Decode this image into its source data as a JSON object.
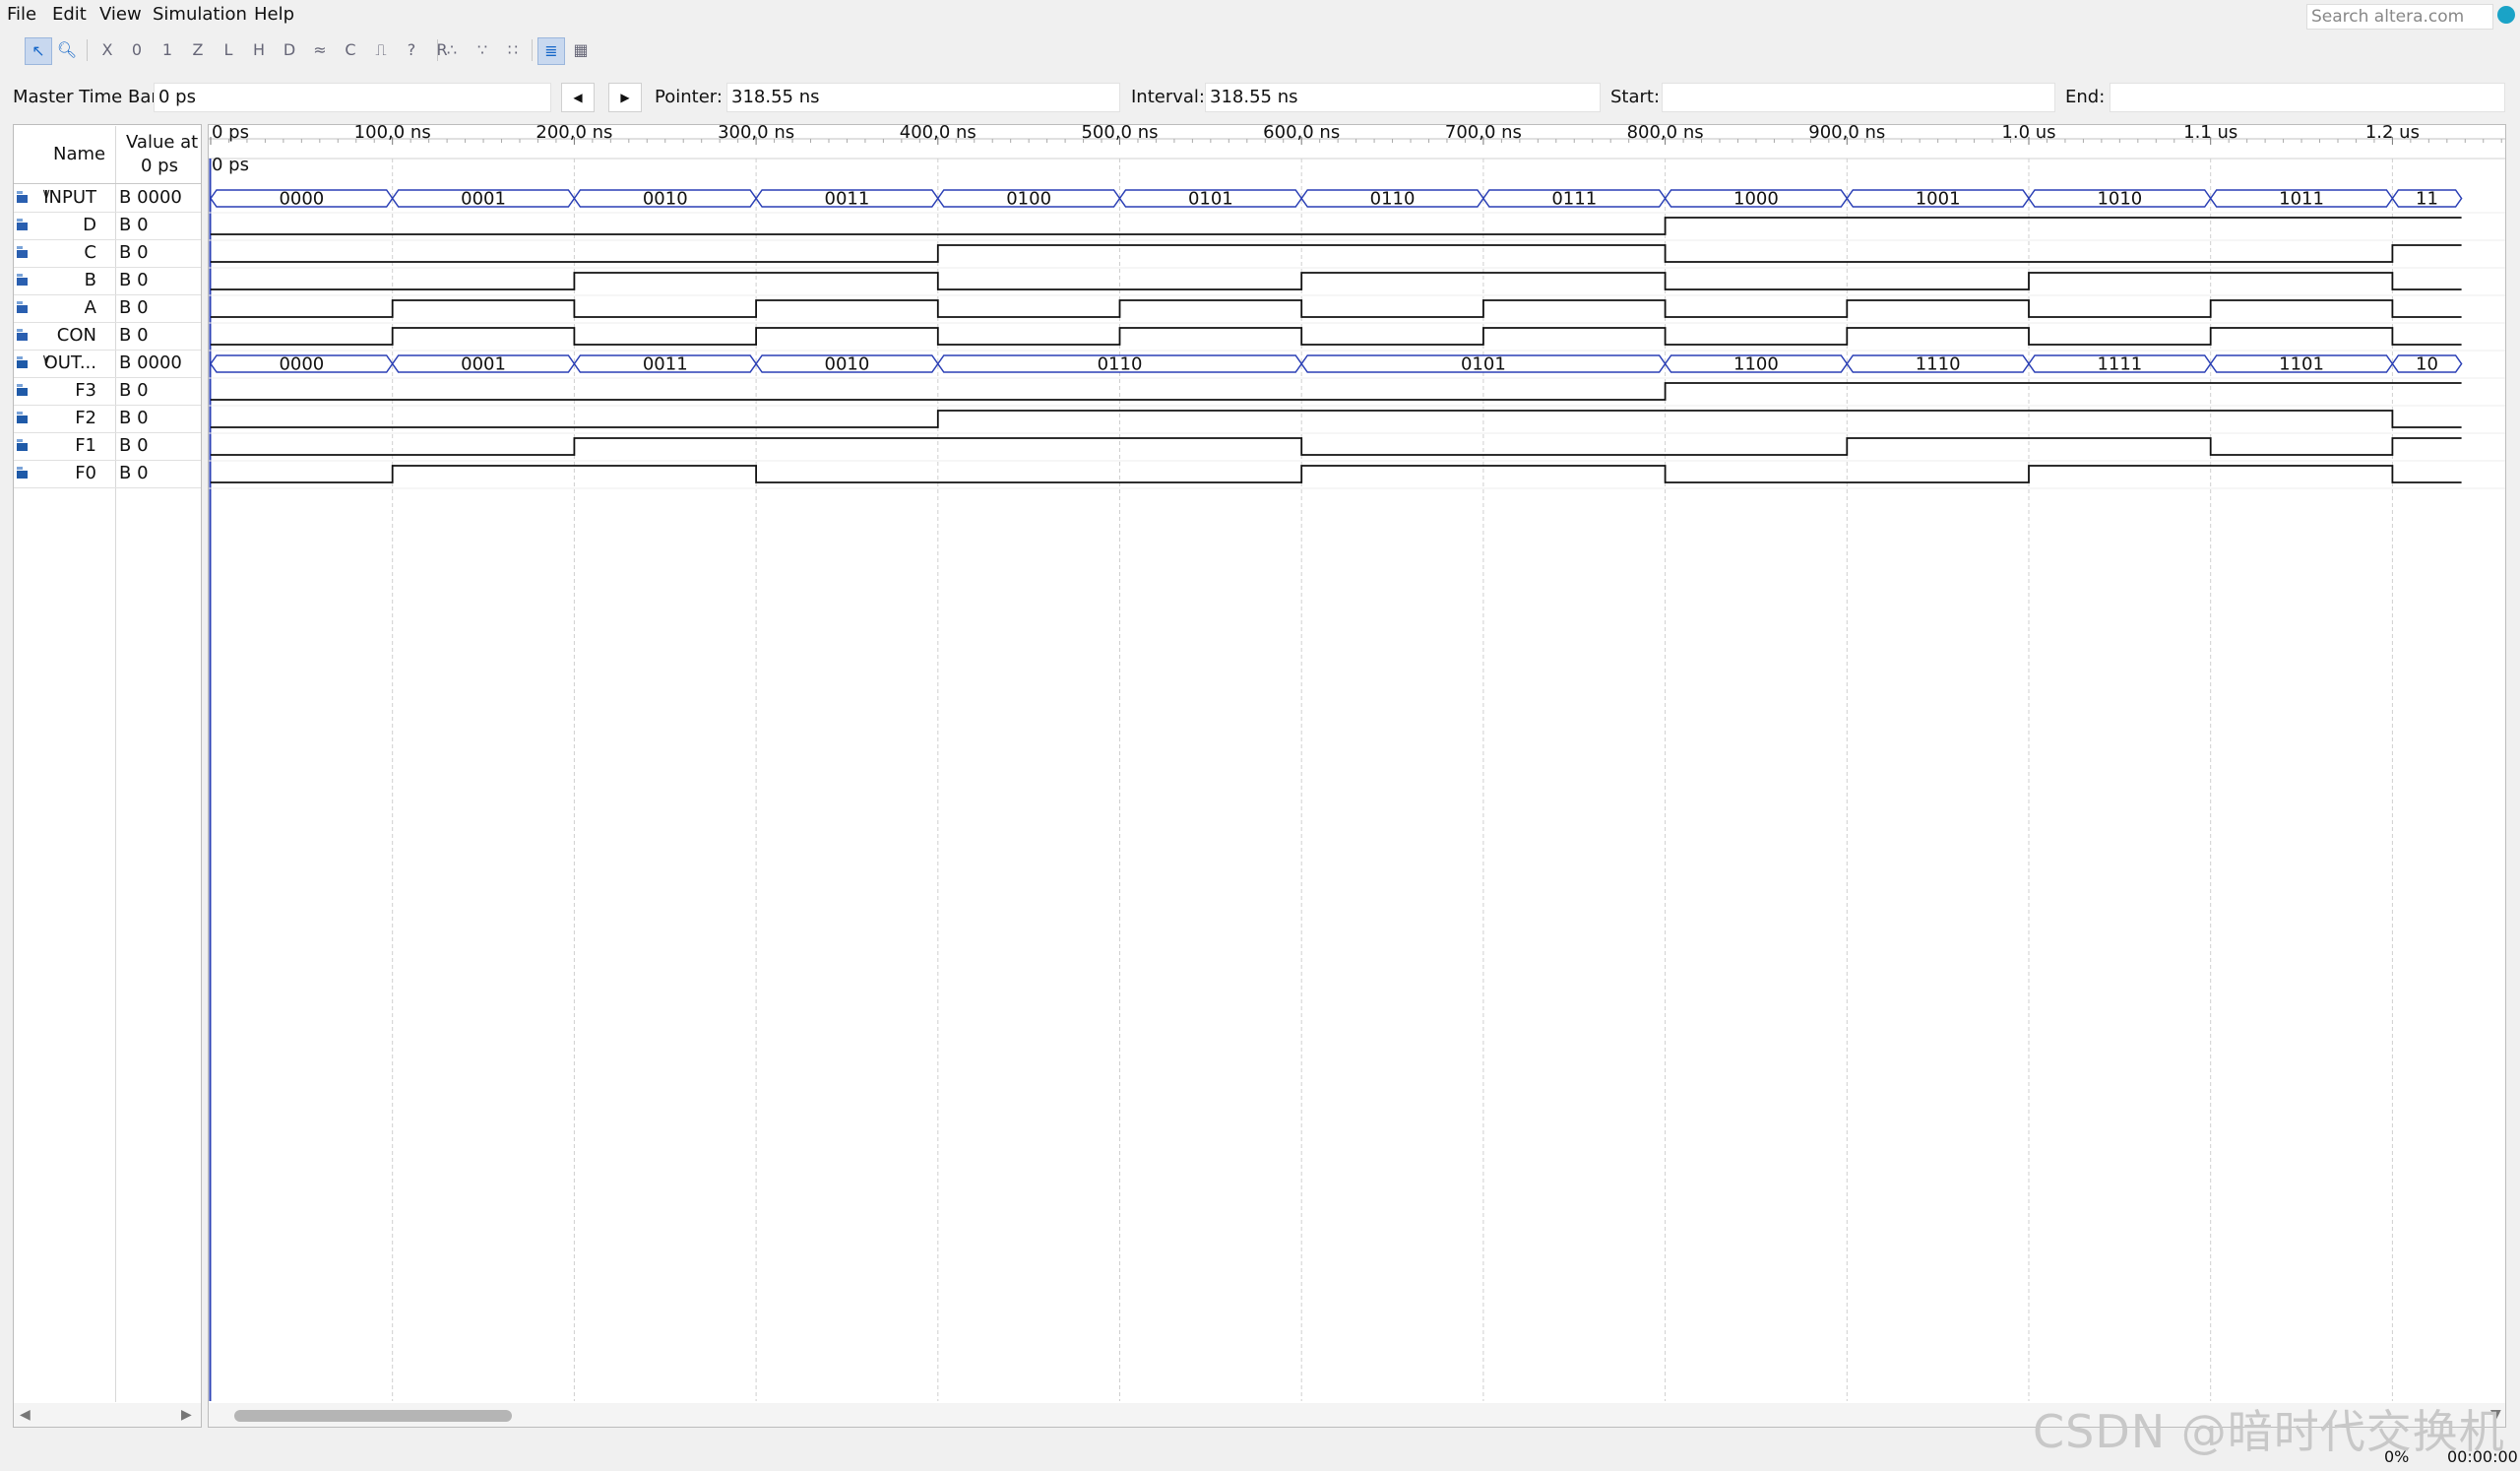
{
  "menu": [
    "File",
    "Edit",
    "View",
    "Simulation",
    "Help"
  ],
  "search": {
    "placeholder": "Search altera.com"
  },
  "toolbar": {
    "icons": [
      "pointer-icon",
      "zoom-icon",
      "force-unknown-icon",
      "force-low-icon",
      "force-high-icon",
      "force-hiz-icon",
      "force-weak-low-icon",
      "force-weak-high-icon",
      "force-dont-care-icon",
      "invert-icon",
      "count-value-icon",
      "clock-icon",
      "arbitrary-value-icon",
      "random-value-icon",
      "snap-to-grid-icon",
      "group-icon",
      "ungroup-icon",
      "waveform-compare-icon",
      "grid-icon"
    ]
  },
  "timebar": {
    "master_label": "Master Time Bar:",
    "master_value": "0 ps",
    "pointer_label": "Pointer:",
    "pointer_value": "318.55 ns",
    "interval_label": "Interval:",
    "interval_value": "318.55 ns",
    "start_label": "Start:",
    "start_value": "",
    "end_label": "End:",
    "end_value": ""
  },
  "header": {
    "name": "Name",
    "value_at": "Value at",
    "value_time": "0 ps",
    "cursor_label": "0 ps"
  },
  "ruler": [
    "0 ps",
    "100,0 ns",
    "200,0 ns",
    "300,0 ns",
    "400,0 ns",
    "500,0 ns",
    "600,0 ns",
    "700,0 ns",
    "800,0 ns",
    "900,0 ns",
    "1.0 us",
    "1.1 us",
    "1.2 us"
  ],
  "signals": [
    {
      "name": "INPUT",
      "value": "B 0000",
      "type": "in-bus",
      "expanded": true,
      "segments": [
        {
          "t": 0,
          "v": "0000"
        },
        {
          "t": 100,
          "v": "0001"
        },
        {
          "t": 200,
          "v": "0010"
        },
        {
          "t": 300,
          "v": "0011"
        },
        {
          "t": 400,
          "v": "0100"
        },
        {
          "t": 500,
          "v": "0101"
        },
        {
          "t": 600,
          "v": "0110"
        },
        {
          "t": 700,
          "v": "0111"
        },
        {
          "t": 800,
          "v": "1000"
        },
        {
          "t": 900,
          "v": "1001"
        },
        {
          "t": 1000,
          "v": "1010"
        },
        {
          "t": 1100,
          "v": "1011"
        },
        {
          "t": 1200,
          "v": "11"
        }
      ]
    },
    {
      "name": "D",
      "value": "B 0",
      "type": "in",
      "levels": [
        0,
        0,
        0,
        0,
        0,
        0,
        0,
        0,
        1,
        1,
        1,
        1,
        1
      ]
    },
    {
      "name": "C",
      "value": "B 0",
      "type": "in",
      "levels": [
        0,
        0,
        0,
        0,
        1,
        1,
        1,
        1,
        0,
        0,
        0,
        0,
        1
      ]
    },
    {
      "name": "B",
      "value": "B 0",
      "type": "in",
      "levels": [
        0,
        0,
        1,
        1,
        0,
        0,
        1,
        1,
        0,
        0,
        1,
        1,
        0
      ]
    },
    {
      "name": "A",
      "value": "B 0",
      "type": "in",
      "levels": [
        0,
        1,
        0,
        1,
        0,
        1,
        0,
        1,
        0,
        1,
        0,
        1,
        0
      ]
    },
    {
      "name": "CON",
      "value": "B 0",
      "type": "in",
      "levels": [
        0,
        1,
        0,
        1,
        0,
        1,
        0,
        1,
        0,
        1,
        0,
        1,
        0
      ]
    },
    {
      "name": "OUT...",
      "value": "B 0000",
      "type": "out-bus",
      "expanded": true,
      "segments": [
        {
          "t": 0,
          "v": "0000"
        },
        {
          "t": 100,
          "v": "0001"
        },
        {
          "t": 200,
          "v": "0011"
        },
        {
          "t": 300,
          "v": "0010"
        },
        {
          "t": 400,
          "v": "0110"
        },
        {
          "t": 600,
          "v": "0101"
        },
        {
          "t": 800,
          "v": "1100"
        },
        {
          "t": 900,
          "v": "1110"
        },
        {
          "t": 1000,
          "v": "1111"
        },
        {
          "t": 1100,
          "v": "1101"
        },
        {
          "t": 1200,
          "v": "10"
        }
      ]
    },
    {
      "name": "F3",
      "value": "B 0",
      "type": "out",
      "levels": [
        0,
        0,
        0,
        0,
        0,
        0,
        0,
        0,
        1,
        1,
        1,
        1,
        1
      ]
    },
    {
      "name": "F2",
      "value": "B 0",
      "type": "out",
      "levels": [
        0,
        0,
        0,
        0,
        1,
        1,
        1,
        1,
        1,
        1,
        1,
        1,
        0
      ]
    },
    {
      "name": "F1",
      "value": "B 0",
      "type": "out",
      "levels": [
        0,
        0,
        1,
        1,
        1,
        1,
        0,
        0,
        0,
        1,
        1,
        0,
        1
      ]
    },
    {
      "name": "F0",
      "value": "B 0",
      "type": "out",
      "levels": [
        0,
        1,
        1,
        0,
        0,
        0,
        1,
        1,
        0,
        0,
        1,
        1,
        0
      ]
    }
  ],
  "status": {
    "progress": "0%",
    "time": "00:00:00"
  },
  "watermark": "CSDN @暗时代交换机"
}
